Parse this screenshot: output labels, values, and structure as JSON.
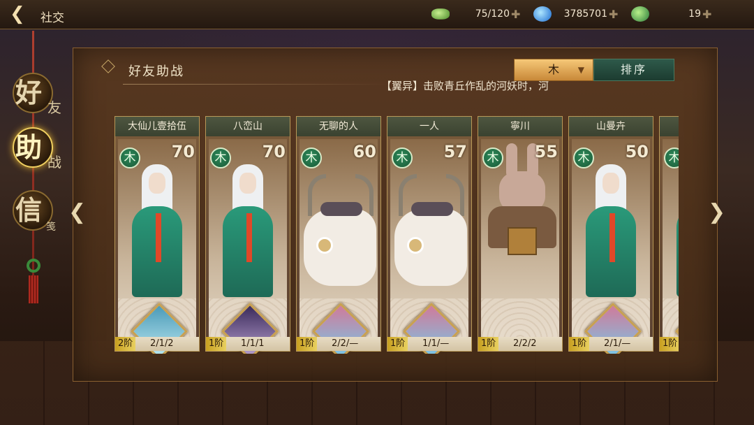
{
  "header": {
    "title": "社交",
    "back_icon": "back-arrow-icon",
    "resources": [
      {
        "icon": "jade-icon",
        "value": "75/120"
      },
      {
        "icon": "magatama-icon",
        "value": "3785701"
      },
      {
        "icon": "leaf-icon",
        "value": "19"
      }
    ]
  },
  "nav": {
    "items": [
      {
        "big": "好",
        "small": "友",
        "active": false
      },
      {
        "big": "助",
        "small": "战",
        "active": true
      },
      {
        "big": "信",
        "small": "笺",
        "active": false
      }
    ]
  },
  "panel": {
    "section_title": "好友助战",
    "marquee": "【翼异】击败青丘作乱的河妖时，河",
    "filter_label": "木",
    "sort_label": "排序"
  },
  "colors": {
    "wood_attr": "#2e8a5a",
    "rank_gold": "#e0c040",
    "filter_orange": "#e8a858",
    "sort_green": "#2e5a4a"
  },
  "cards": [
    {
      "name": "大仙儿壹拾伍",
      "attr": "木",
      "level": "70",
      "art": "sage",
      "soul": "a",
      "rank": "2阶",
      "slots": "2/1/2"
    },
    {
      "name": "八峦山",
      "attr": "木",
      "level": "70",
      "art": "sage",
      "soul": "b",
      "rank": "1阶",
      "slots": "1/1/1"
    },
    {
      "name": "无聊的人",
      "attr": "木",
      "level": "60",
      "art": "beast",
      "soul": "c",
      "rank": "1阶",
      "slots": "2/2/—"
    },
    {
      "name": "一人",
      "attr": "木",
      "level": "57",
      "art": "beast",
      "soul": "c",
      "rank": "1阶",
      "slots": "1/1/—"
    },
    {
      "name": "寧川",
      "attr": "木",
      "level": "55",
      "art": "rabbit",
      "soul": "",
      "rank": "1阶",
      "slots": "2/2/2"
    },
    {
      "name": "山曼卉",
      "attr": "木",
      "level": "50",
      "art": "sage",
      "soul": "c",
      "rank": "1阶",
      "slots": "2/1/—"
    },
    {
      "name": "",
      "attr": "木",
      "level": "",
      "art": "sage",
      "soul": "b",
      "rank": "1阶",
      "slots": ""
    }
  ]
}
